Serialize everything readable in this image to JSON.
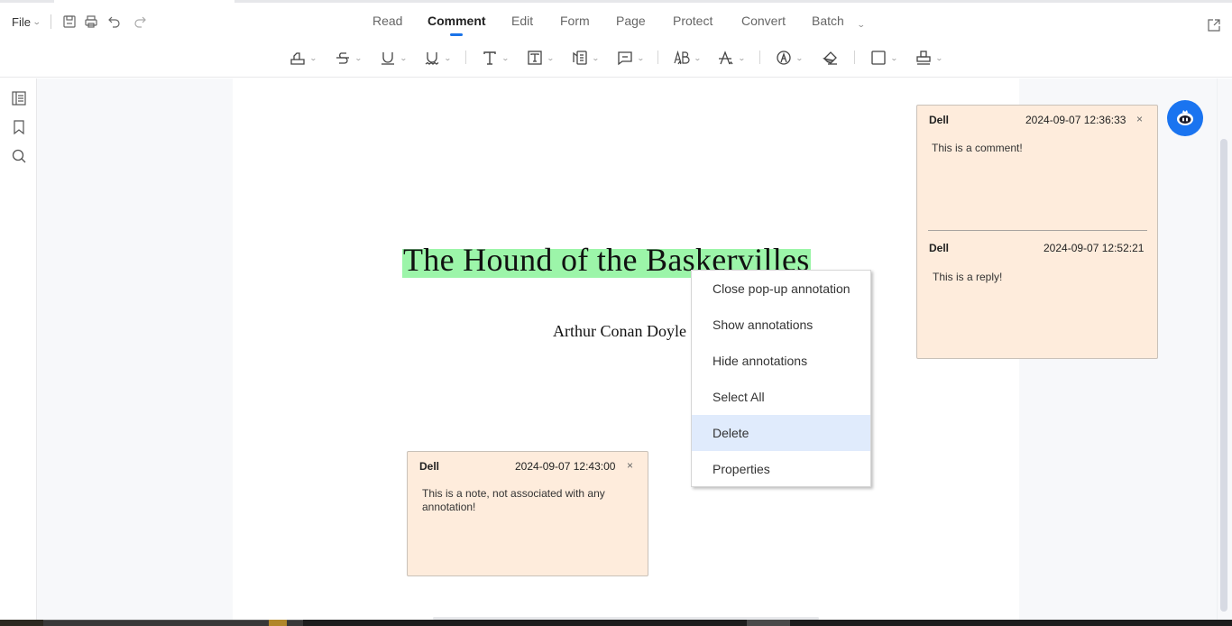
{
  "menu": {
    "file_label": "File"
  },
  "quick_actions": [
    {
      "name": "save-icon"
    },
    {
      "name": "print-icon"
    },
    {
      "name": "undo-icon"
    },
    {
      "name": "redo-icon"
    }
  ],
  "tabs": [
    {
      "label": "Read",
      "active": false
    },
    {
      "label": "Comment",
      "active": true
    },
    {
      "label": "Edit",
      "active": false
    },
    {
      "label": "Form",
      "active": false
    },
    {
      "label": "Page",
      "active": false
    },
    {
      "label": "Protect",
      "active": false
    },
    {
      "label": "Convert",
      "active": false
    },
    {
      "label": "Batch",
      "active": false
    }
  ],
  "comment_tools": [
    {
      "icon": "highlight-icon"
    },
    {
      "icon": "strikethrough-icon"
    },
    {
      "icon": "underline-icon"
    },
    {
      "icon": "squiggly-underline-icon"
    },
    {
      "icon": "typewriter-text-icon"
    },
    {
      "icon": "text-box-icon"
    },
    {
      "icon": "callout-icon"
    },
    {
      "icon": "sticky-note-icon"
    },
    {
      "icon": "insert-text-icon"
    },
    {
      "icon": "replace-text-icon"
    },
    {
      "icon": "pencil-draw-icon"
    },
    {
      "icon": "eraser-icon"
    },
    {
      "icon": "shape-rectangle-icon"
    },
    {
      "icon": "stamp-icon"
    }
  ],
  "sidebar": [
    {
      "icon": "thumbnails-icon"
    },
    {
      "icon": "bookmark-icon"
    },
    {
      "icon": "search-icon"
    }
  ],
  "document": {
    "title": "The Hound of the Baskervilles",
    "author": "Arthur Conan Doyle",
    "highlight_color": "#9cf5a9"
  },
  "comment_popup": {
    "comments": [
      {
        "author": "Dell",
        "time": "2024-09-07 12:36:33",
        "text": "This is a comment!"
      },
      {
        "author": "Dell",
        "time": "2024-09-07 12:52:21",
        "text": "This is a reply!"
      }
    ]
  },
  "note_popup": {
    "author": "Dell",
    "time": "2024-09-07 12:43:00",
    "text": "This is a note, not associated with any annotation!"
  },
  "context_menu": {
    "items": [
      {
        "label": "Close pop-up annotation"
      },
      {
        "label": "Show annotations"
      },
      {
        "label": "Hide annotations"
      },
      {
        "label": "Select All"
      },
      {
        "label": "Delete",
        "hovered": true
      },
      {
        "label": "Properties"
      }
    ]
  },
  "colors": {
    "accent": "#1a73e8",
    "popup_bg": "#feecdc",
    "menu_hover": "#e0ebfc",
    "assistant": "#1a74f0"
  },
  "close_glyph": "×"
}
